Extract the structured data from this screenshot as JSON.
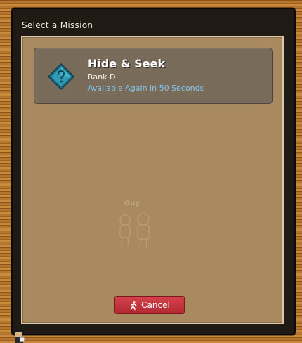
{
  "dialog": {
    "title": "Select a Mission"
  },
  "mission": {
    "name": "Hide & Seek",
    "rank": "Rank D",
    "availability": "Available Again in 50 Seconds",
    "icon": "question-diamond-icon"
  },
  "background_npc": {
    "name": "Guy"
  },
  "cancel_button": {
    "label": "Cancel",
    "icon": "walking-person-icon"
  },
  "colors": {
    "panel_bg": "#1f1a13",
    "content_bg": "#a98a60",
    "card_bg": "#786b5a",
    "availability_text": "#86c6ec",
    "cancel_button": "#c7343d",
    "wood": "#b9762e"
  }
}
